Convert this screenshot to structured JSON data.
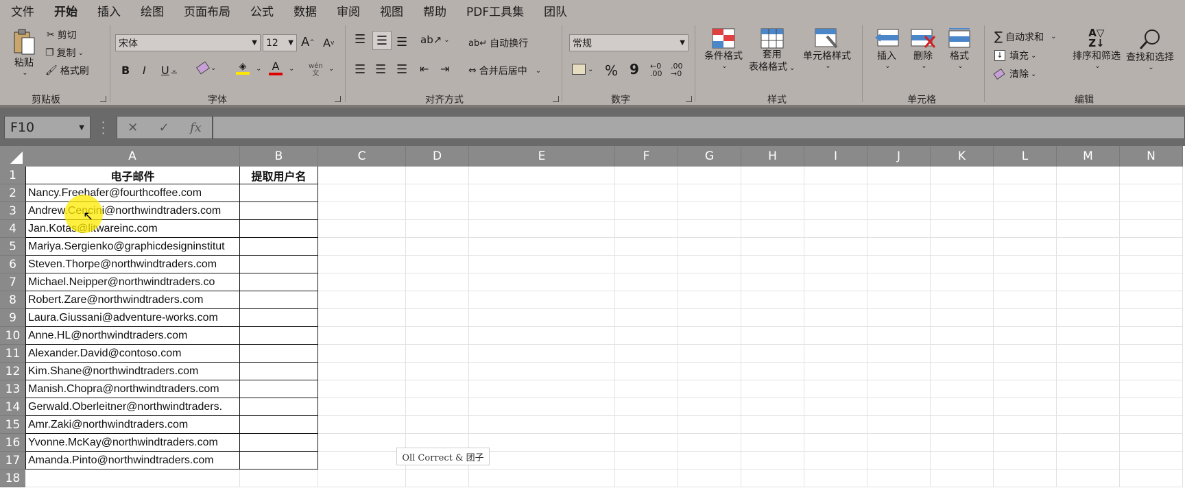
{
  "menu": [
    "文件",
    "开始",
    "插入",
    "绘图",
    "页面布局",
    "公式",
    "数据",
    "审阅",
    "视图",
    "帮助",
    "PDF工具集",
    "团队"
  ],
  "active_menu": "开始",
  "ribbon": {
    "clipboard": {
      "paste": "粘贴",
      "cut": "剪切",
      "copy": "复制",
      "format_painter": "格式刷",
      "label": "剪贴板"
    },
    "font": {
      "name": "宋体",
      "size": "12",
      "label": "字体",
      "bold": "B",
      "italic": "I",
      "underline": "U",
      "wen": "wén",
      "wen_char": "文"
    },
    "alignment": {
      "wrap": "自动换行",
      "merge": "合并后居中",
      "label": "对齐方式"
    },
    "number": {
      "format": "常规",
      "label": "数字",
      "percent": "%",
      "comma": "9"
    },
    "styles": {
      "conditional": "条件格式",
      "table_line1": "套用",
      "table_line2": "表格格式",
      "cell_styles": "单元格样式",
      "label": "样式"
    },
    "cells": {
      "insert": "插入",
      "delete": "删除",
      "format": "格式",
      "label": "单元格"
    },
    "editing": {
      "autosum": "自动求和",
      "fill": "填充",
      "clear": "清除",
      "sort": "排序和筛选",
      "find": "查找和选择",
      "label": "编辑"
    }
  },
  "formula_bar": {
    "name_box": "F10",
    "cancel": "✕",
    "enter": "✓",
    "fx": "fx",
    "formula": ""
  },
  "columns": [
    "A",
    "B",
    "C",
    "D",
    "E",
    "F",
    "G",
    "H",
    "I",
    "J",
    "K",
    "L",
    "M",
    "N"
  ],
  "rows": [
    "1",
    "2",
    "3",
    "4",
    "5",
    "6",
    "7",
    "8",
    "9",
    "10",
    "11",
    "12",
    "13",
    "14",
    "15",
    "16",
    "17",
    "18"
  ],
  "headers": {
    "a1": "电子邮件",
    "b1": "提取用户名"
  },
  "emails": [
    "Nancy.Freehafer@fourthcoffee.com",
    "Andrew.Cencini@northwindtraders.com",
    "Jan.Kotas@litwareinc.com",
    "Mariya.Sergienko@graphicdesigninstitut",
    "Steven.Thorpe@northwindtraders.com",
    "Michael.Neipper@northwindtraders.co",
    "Robert.Zare@northwindtraders.com",
    "Laura.Giussani@adventure-works.com",
    "Anne.HL@northwindtraders.com",
    "Alexander.David@contoso.com",
    "Kim.Shane@northwindtraders.com",
    "Manish.Chopra@northwindtraders.com",
    "Gerwald.Oberleitner@northwindtraders.",
    "Amr.Zaki@northwindtraders.com",
    "Yvonne.McKay@northwindtraders.com",
    "Amanda.Pinto@northwindtraders.com"
  ],
  "watermark": "Oll Correct & 团子"
}
